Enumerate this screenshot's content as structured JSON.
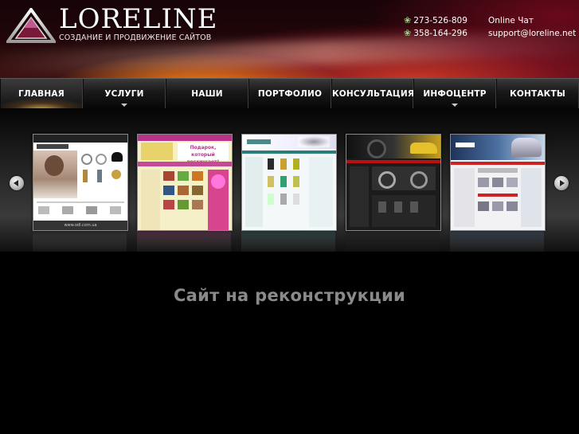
{
  "header": {
    "logo_name": "LORELINE",
    "logo_tagline": "СОЗДАНИЕ И ПРОДВИЖЕНИЕ САЙТОВ",
    "phone_1": "273-526-809",
    "phone_2": "358-164-296",
    "online_chat": "Online Чат",
    "email": "support@loreline.net",
    "phone_icon": "flower-icon"
  },
  "nav": {
    "items": [
      {
        "label": "ГЛАВНАЯ",
        "active": true,
        "has_dropdown": false
      },
      {
        "label": "УСЛУГИ",
        "active": false,
        "has_dropdown": true
      },
      {
        "label": "НАШИ КЛИЕНТЫ",
        "active": false,
        "has_dropdown": false
      },
      {
        "label": "ПОРТФОЛИО",
        "active": false,
        "has_dropdown": false
      },
      {
        "label": "КОНСУЛЬТАЦИЯ",
        "active": false,
        "has_dropdown": false
      },
      {
        "label": "ИНФОЦЕНТР",
        "active": false,
        "has_dropdown": true
      },
      {
        "label": "КОНТАКТЫ",
        "active": false,
        "has_dropdown": false
      }
    ]
  },
  "gallery": {
    "prev_icon": "arrow-left-icon",
    "next_icon": "arrow-right-icon",
    "thumbnails": [
      {
        "name": "jewelry-site",
        "caption": "www.odl.com.ua"
      },
      {
        "name": "gifts-site",
        "caption": "Подарок, который восхищает!"
      },
      {
        "name": "cosmetics-site",
        "caption": ""
      },
      {
        "name": "tires-site",
        "caption": ""
      },
      {
        "name": "auto-site",
        "caption": ""
      }
    ]
  },
  "main": {
    "message": "Сайт на реконструкции"
  },
  "colors": {
    "accent_glow": "#f0a030",
    "nav_text": "#ffffff",
    "message_text": "#8a8a8a",
    "phone_icon": "#9fd08a"
  }
}
